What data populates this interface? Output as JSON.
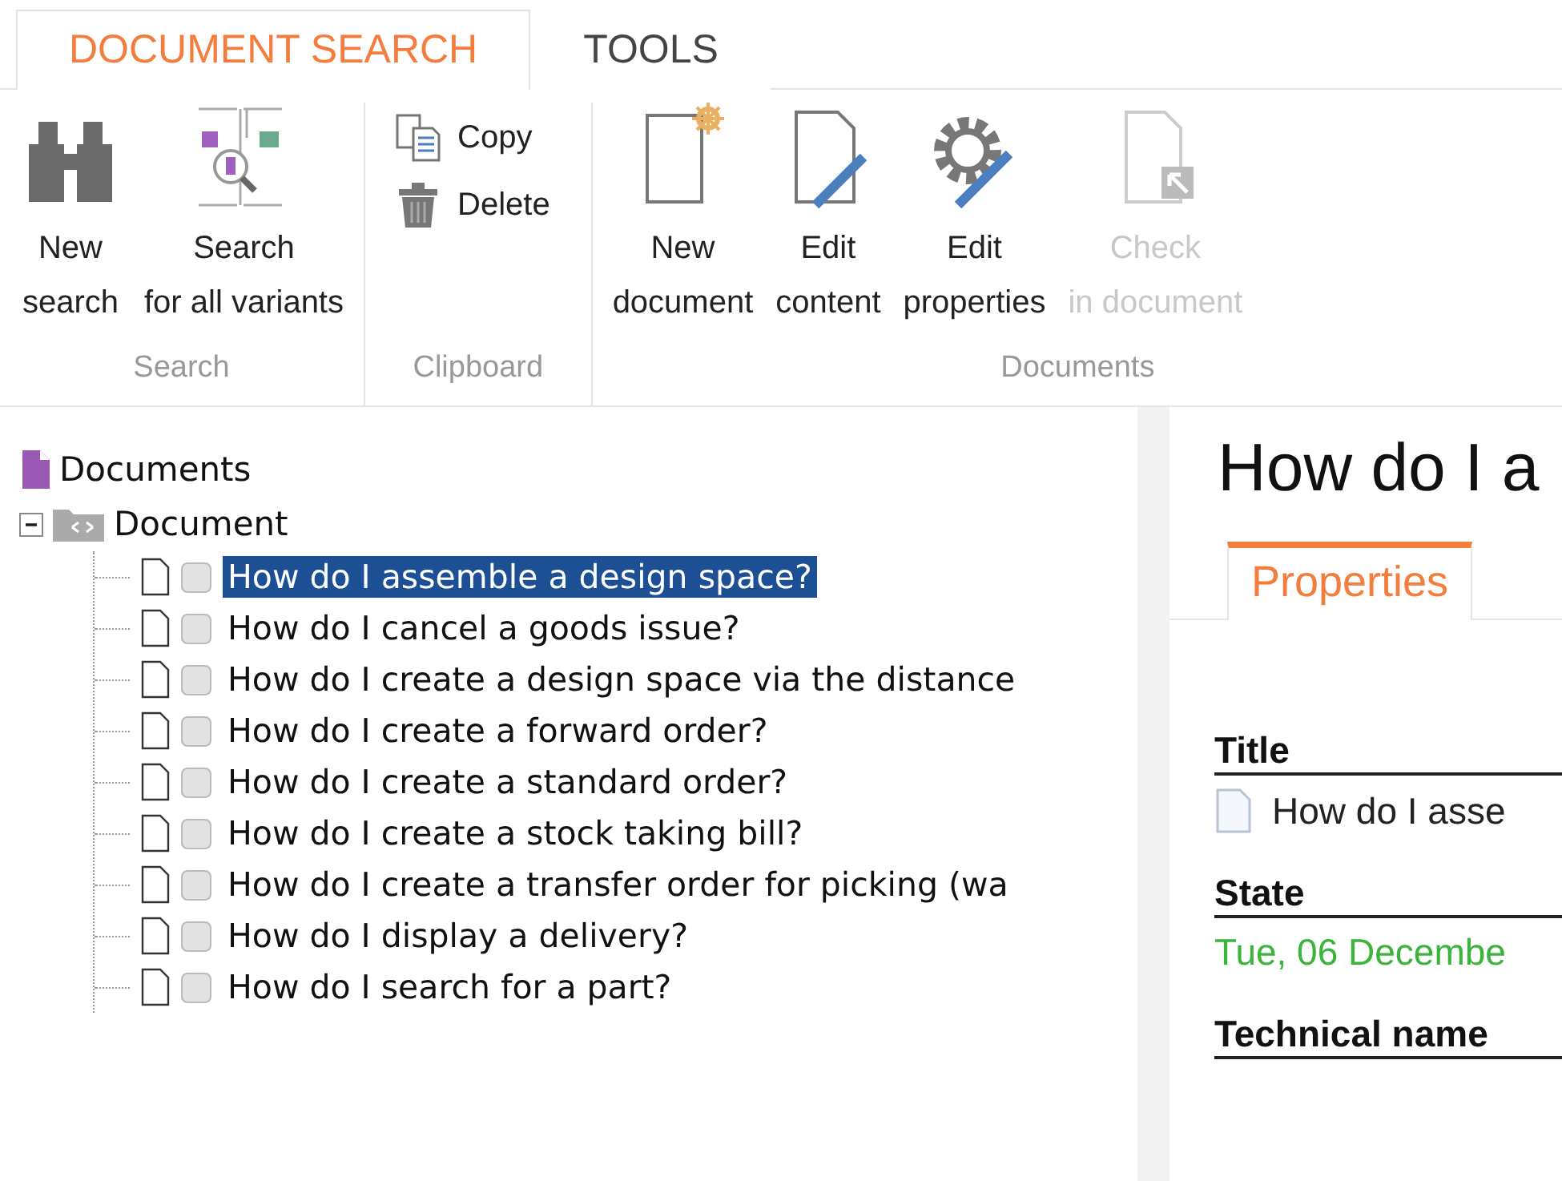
{
  "tabs": [
    {
      "label": "DOCUMENT SEARCH",
      "selected": true
    },
    {
      "label": "TOOLS",
      "selected": false
    }
  ],
  "ribbon": {
    "groups": [
      {
        "label": "Search",
        "buttons": [
          {
            "kind": "binoculars",
            "lines": [
              "New",
              "search"
            ],
            "disabled": false
          },
          {
            "kind": "variants",
            "lines": [
              "Search",
              "for all variants"
            ],
            "disabled": false
          }
        ]
      },
      {
        "label": "Clipboard",
        "small_buttons": [
          {
            "kind": "copy",
            "label": "Copy"
          },
          {
            "kind": "delete",
            "label": "Delete"
          }
        ]
      },
      {
        "label": "Documents",
        "buttons": [
          {
            "kind": "new",
            "lines": [
              "New",
              "document"
            ],
            "disabled": false
          },
          {
            "kind": "edit",
            "lines": [
              "Edit",
              "content"
            ],
            "disabled": false
          },
          {
            "kind": "props",
            "lines": [
              "Edit",
              "properties"
            ],
            "disabled": false
          },
          {
            "kind": "checkin",
            "lines": [
              "Check",
              "in document"
            ],
            "disabled": true
          }
        ]
      }
    ]
  },
  "tree": {
    "root": "Documents",
    "folder": {
      "label": "Document",
      "expanded": true,
      "children": [
        {
          "label": "How do I assemble a design space?",
          "selected": true,
          "checked": false
        },
        {
          "label": "How do I cancel a goods issue?",
          "selected": false,
          "checked": false
        },
        {
          "label": "How do I create a design space via the distance",
          "selected": false,
          "checked": false
        },
        {
          "label": "How do I create a forward order?",
          "selected": false,
          "checked": false
        },
        {
          "label": "How do I create a standard order?",
          "selected": false,
          "checked": false
        },
        {
          "label": "How do I create a stock taking bill?",
          "selected": false,
          "checked": false
        },
        {
          "label": "How do I create a transfer order for picking (wa",
          "selected": false,
          "checked": false
        },
        {
          "label": "How do I display a delivery?",
          "selected": false,
          "checked": false
        },
        {
          "label": "How do I search for a part?",
          "selected": false,
          "checked": false
        }
      ]
    }
  },
  "detail": {
    "title": "How do I a",
    "tabs": [
      {
        "label": "Properties",
        "selected": true
      }
    ],
    "sections": [
      {
        "heading": "Title",
        "kind": "doc",
        "value": "How do I asse"
      },
      {
        "heading": "State",
        "kind": "state",
        "value": "Tue, 06 Decembe"
      },
      {
        "heading": "Technical name",
        "kind": "text"
      }
    ]
  }
}
